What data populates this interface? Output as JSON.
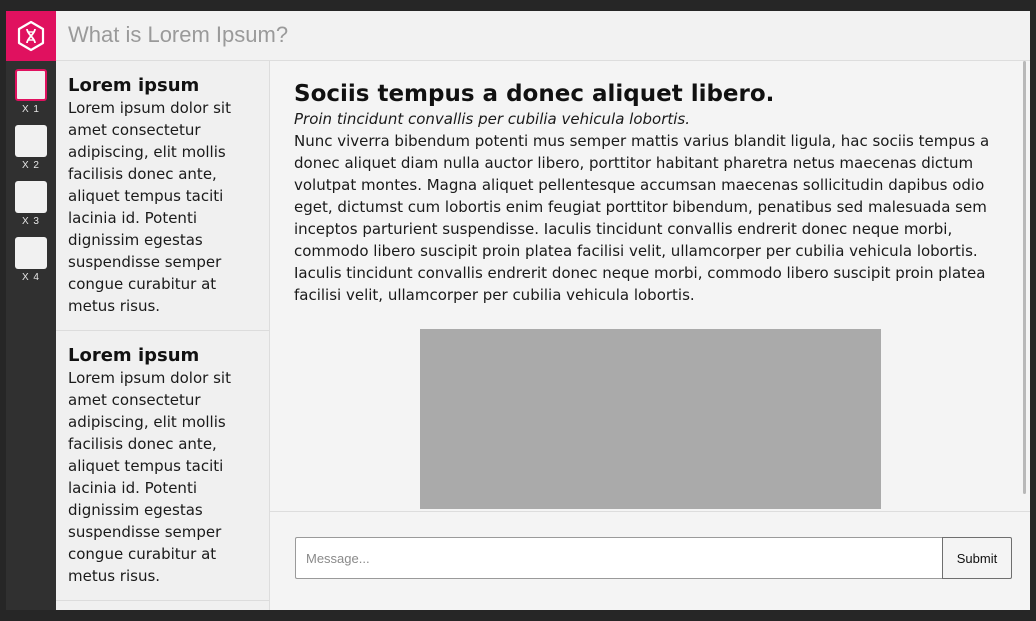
{
  "header": {
    "title": "What is Lorem Ipsum?",
    "logo_icon": "hexagon-dna-icon",
    "brand_color": "#e0115f"
  },
  "rail": {
    "items": [
      {
        "label": "X 1",
        "active": true
      },
      {
        "label": "X 2",
        "active": false
      },
      {
        "label": "X 3",
        "active": false
      },
      {
        "label": "X 4",
        "active": false
      }
    ]
  },
  "list": {
    "items": [
      {
        "title": "Lorem ipsum",
        "text": "Lorem ipsum dolor sit amet consectetur adipiscing, elit mollis facilisis donec ante, aliquet tempus taciti lacinia id. Potenti dignissim egestas suspendisse semper congue curabitur at metus risus."
      },
      {
        "title": "Lorem ipsum",
        "text": "Lorem ipsum dolor sit amet consectetur adipiscing, elit mollis facilisis donec ante, aliquet tempus taciti lacinia id. Potenti dignissim egestas suspendisse semper congue curabitur at metus risus."
      }
    ]
  },
  "article": {
    "title": "Sociis tempus a donec aliquet libero.",
    "subtitle": "Proin tincidunt convallis per cubilia vehicula lobortis.",
    "body": "Nunc viverra bibendum potenti mus semper mattis varius blandit ligula, hac sociis tempus a donec aliquet diam nulla auctor libero, porttitor habitant pharetra netus maecenas dictum volutpat montes. Magna aliquet pellentesque accumsan maecenas sollicitudin dapibus odio eget, dictumst cum lobortis enim feugiat porttitor bibendum, penatibus sed malesuada sem inceptos parturient suspendisse. Iaculis tincidunt convallis endrerit donec neque morbi, commodo libero suscipit proin platea facilisi velit, ullamcorper per cubilia vehicula lobortis. Iaculis tincidunt convallis endrerit donec neque morbi, commodo libero suscipit proin platea facilisi velit, ullamcorper per cubilia vehicula lobortis."
  },
  "composer": {
    "placeholder": "Message...",
    "submit_label": "Submit"
  }
}
